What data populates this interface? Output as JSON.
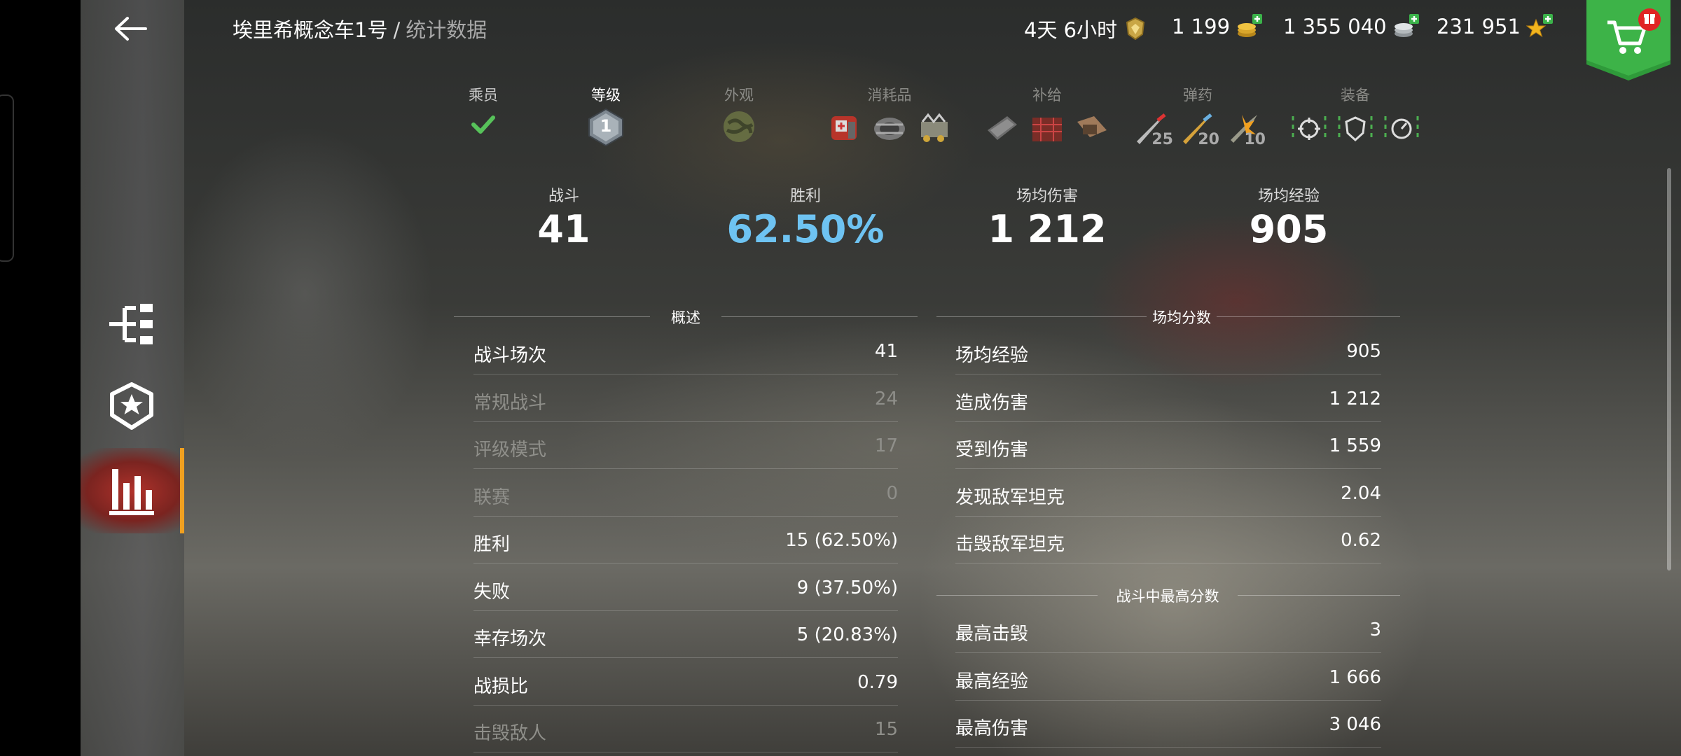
{
  "header": {
    "vehicle_name": "埃里希概念车1号",
    "separator": "/",
    "section": "统计数据"
  },
  "currencies": [
    {
      "value": "4天 6小时",
      "icon": "premium-time-icon"
    },
    {
      "value": "1 199",
      "icon": "gold-icon"
    },
    {
      "value": "1 355 040",
      "icon": "credits-icon"
    },
    {
      "value": "231 951",
      "icon": "free-xp-icon"
    }
  ],
  "shop": {
    "icon": "shop-cart-icon",
    "badge_icon": "gift-icon"
  },
  "sidebar": {
    "items": [
      {
        "name": "modules",
        "icon": "tech-tree-icon"
      },
      {
        "name": "rank",
        "icon": "star-shield-icon"
      },
      {
        "name": "statistics",
        "icon": "bar-chart-icon",
        "active": true
      }
    ]
  },
  "loadout": {
    "crew_label": "乘员",
    "level_label": "等级",
    "level_value": "1",
    "appearance_label": "外观",
    "consumables_label": "消耗品",
    "supplies_label": "补给",
    "ammo_label": "弹药",
    "ammo_counts": [
      "25",
      "20",
      "10"
    ],
    "equipment_label": "装备"
  },
  "summary": {
    "battles_label": "战斗",
    "battles_value": "41",
    "wins_label": "胜利",
    "wins_value": "62.50%",
    "avg_damage_label": "场均伤害",
    "avg_damage_value": "1 212",
    "avg_xp_label": "场均经验",
    "avg_xp_value": "905"
  },
  "overview": {
    "title": "概述",
    "rows": [
      {
        "k": "战斗场次",
        "v": "41",
        "dim": false
      },
      {
        "k": "常规战斗",
        "v": "24",
        "dim": true
      },
      {
        "k": "评级模式",
        "v": "17",
        "dim": true
      },
      {
        "k": "联赛",
        "v": "0",
        "dim": true
      },
      {
        "k": "胜利",
        "v": "15 (62.50%)",
        "dim": false
      },
      {
        "k": "失败",
        "v": "9 (37.50%)",
        "dim": false
      },
      {
        "k": "幸存场次",
        "v": "5 (20.83%)",
        "dim": false
      },
      {
        "k": "战损比",
        "v": "0.79",
        "dim": false
      },
      {
        "k": "击毁敌人",
        "v": "15",
        "dim": true
      }
    ]
  },
  "avg_score": {
    "title": "场均分数",
    "rows": [
      {
        "k": "场均经验",
        "v": "905"
      },
      {
        "k": "造成伤害",
        "v": "1 212"
      },
      {
        "k": "受到伤害",
        "v": "1 559"
      },
      {
        "k": "发现敌军坦克",
        "v": "2.04"
      },
      {
        "k": "击毁敌军坦克",
        "v": "0.62"
      }
    ]
  },
  "best": {
    "title": "战斗中最高分数",
    "rows": [
      {
        "k": "最高击毁",
        "v": "3"
      },
      {
        "k": "最高经验",
        "v": "1 666"
      },
      {
        "k": "最高伤害",
        "v": "3 046"
      }
    ]
  }
}
